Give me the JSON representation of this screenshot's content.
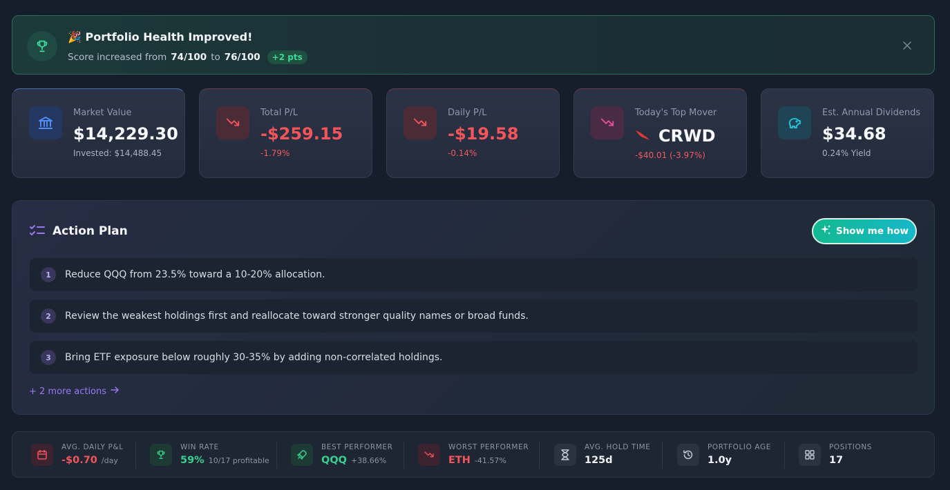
{
  "banner": {
    "title": "🎉 Portfolio Health Improved!",
    "sub_prefix": "Score increased from",
    "from_score": "74/100",
    "to_word": "to",
    "to_score": "76/100",
    "delta": "+2 pts",
    "icons": {
      "main": "trophy-icon",
      "close": "close-icon"
    }
  },
  "cards": [
    {
      "label": "Market Value",
      "value": "$14,229.30",
      "sub": "Invested: $14,488.45",
      "icon": "bank-icon",
      "accent": "#4f8cf7"
    },
    {
      "label": "Total P/L",
      "value": "-$259.15",
      "sub": "-1.79%",
      "icon": "trend-down-icon",
      "accent": "#f2555a"
    },
    {
      "label": "Daily P/L",
      "value": "-$19.58",
      "sub": "-0.14%",
      "icon": "trend-down-icon",
      "accent": "#f2555a"
    },
    {
      "label": "Today's Top Mover",
      "value": "CRWD",
      "sub": "-$40.01 (-3.97%)",
      "icon": "trend-down-icon",
      "accent": "#e84f9b"
    },
    {
      "label": "Est. Annual Dividends",
      "value": "$34.68",
      "sub": "0.24% Yield",
      "icon": "piggy-bank-icon",
      "accent": "#22c3d6"
    }
  ],
  "plan": {
    "title": "Action Plan",
    "button": "Show me how",
    "steps": [
      {
        "num": "1",
        "text": "Reduce QQQ from 23.5% toward a 10-20% allocation."
      },
      {
        "num": "2",
        "text": "Review the weakest holdings first and reallocate toward stronger quality names or broad funds."
      },
      {
        "num": "3",
        "text": "Bring ETF exposure below roughly 30-35% by adding non-correlated holdings."
      }
    ],
    "more": "+ 2 more actions"
  },
  "footer": [
    {
      "label": "AVG. DAILY P&L",
      "value": "-$0.70",
      "extra": "/day",
      "icon": "calendar-icon"
    },
    {
      "label": "WIN RATE",
      "value": "59%",
      "extra": "10/17 profitable",
      "icon": "trophy-icon"
    },
    {
      "label": "BEST PERFORMER",
      "value": "QQQ",
      "extra": "+38.66%",
      "icon": "rocket-icon"
    },
    {
      "label": "WORST PERFORMER",
      "value": "ETH",
      "extra": "-41.57%",
      "icon": "trend-down-icon"
    },
    {
      "label": "AVG. HOLD TIME",
      "value": "125d",
      "extra": "",
      "icon": "hourglass-icon"
    },
    {
      "label": "PORTFOLIO AGE",
      "value": "1.0y",
      "extra": "",
      "icon": "history-icon"
    },
    {
      "label": "POSITIONS",
      "value": "17",
      "extra": "",
      "icon": "grid-icon"
    }
  ],
  "colors": {
    "background": "#161d2b",
    "green": "#38d08e",
    "red": "#f2555a",
    "purple": "#9b78f0",
    "teal": "#17b7c9"
  }
}
